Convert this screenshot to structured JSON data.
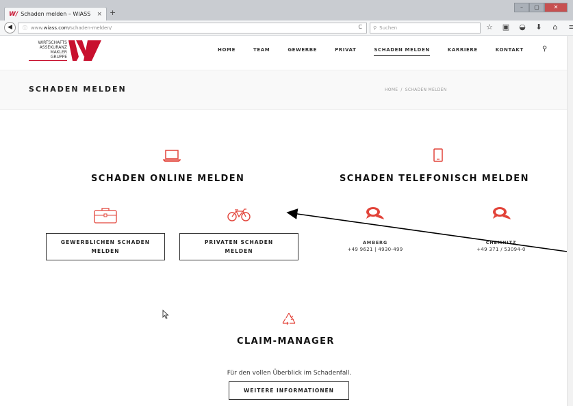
{
  "browser": {
    "tab_title": "Schaden melden – WIASS",
    "tab_logo": "W/",
    "tab_close": "×",
    "new_tab": "+",
    "url_prefix": "www.",
    "url_domain": "wiass.com",
    "url_path": "/schaden-melden/",
    "search_placeholder": "Suchen"
  },
  "logo": {
    "lines": [
      "WIRTSCHAFTS",
      "ASSEKURANZ",
      "MAKLER",
      "GRUPPE"
    ],
    "brand_color": "#c8102e"
  },
  "nav": {
    "items": [
      "HOME",
      "TEAM",
      "GEWERBE",
      "PRIVAT",
      "SCHADEN MELDEN",
      "KARRIERE",
      "KONTAKT"
    ],
    "active_index": 4
  },
  "page": {
    "title": "SCHADEN MELDEN",
    "breadcrumb": [
      "HOME",
      "SCHADEN MELDEN"
    ],
    "breadcrumb_sep": "/"
  },
  "online": {
    "heading": "SCHADEN ONLINE MELDEN",
    "business_button": [
      "GEWERBLICHEN SCHADEN",
      "MELDEN"
    ],
    "private_button": [
      "PRIVATEN SCHADEN",
      "MELDEN"
    ]
  },
  "phone": {
    "heading": "SCHADEN TELEFONISCH MELDEN",
    "locations": [
      {
        "city": "AMBERG",
        "number": "+49 9621 | 4930-499"
      },
      {
        "city": "CHEMNITZ",
        "number": "+49 371 / 53094-0"
      }
    ]
  },
  "claim": {
    "heading": "CLAIM-MANAGER",
    "text": "Für den vollen Überblick im Schadenfall.",
    "button": "WEITERE INFORMATIONEN"
  },
  "colors": {
    "accent": "#e2443a",
    "text": "#222222"
  },
  "icons": {
    "laptop": "laptop-icon",
    "tablet": "tablet-icon",
    "briefcase": "briefcase-icon",
    "bicycle": "bicycle-icon",
    "chat": "chat-bubbles-icon",
    "recycle": "recycle-icon"
  }
}
